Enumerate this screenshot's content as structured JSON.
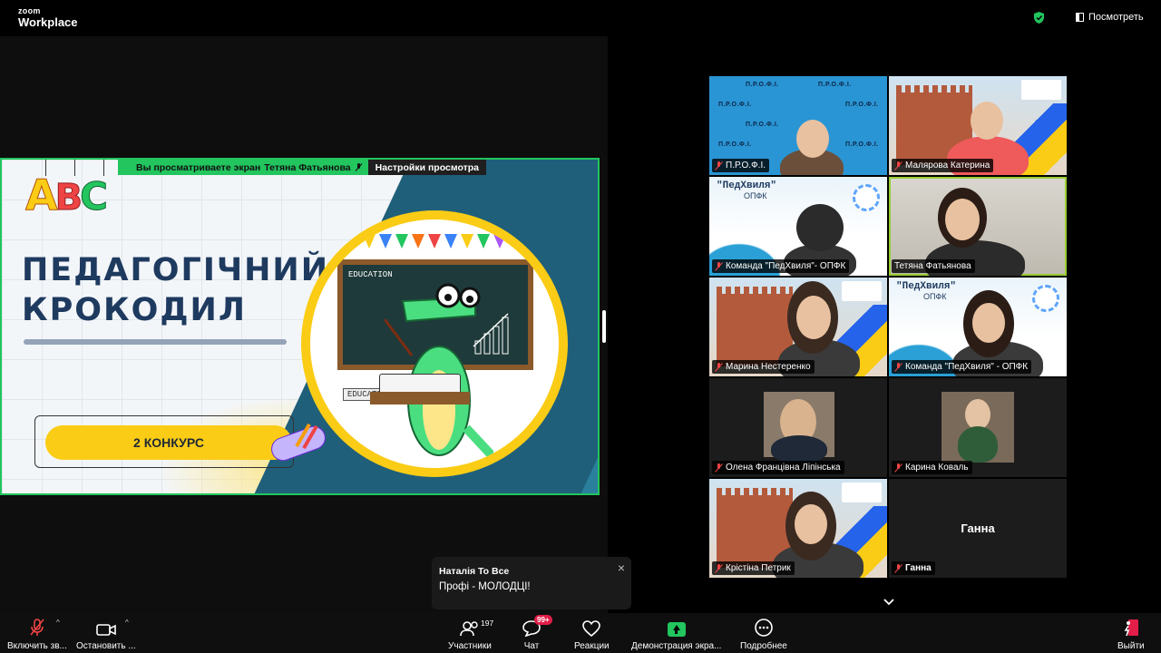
{
  "app": {
    "brand_top": "zoom",
    "brand_bottom": "Workplace",
    "view_button": "Посмотреть"
  },
  "share_banner": {
    "text": "Вы просматриваете экран",
    "presenter": "Тетяна Фатьянова",
    "settings": "Настройки просмотра"
  },
  "slide": {
    "abc": {
      "a": "A",
      "b": "B",
      "c": "C"
    },
    "title_line1": "ПЕДАГОГІЧНИЙ",
    "title_line2": "КРОКОДИЛ",
    "contest": "2 КОНКУРС",
    "board_text": "EDUCATION",
    "board_text2": "EDUCATION",
    "bunting_colors": [
      "#ef4444",
      "#facc15",
      "#3b82f6",
      "#22c55e",
      "#f97316",
      "#ef4444",
      "#3b82f6",
      "#facc15",
      "#22c55e",
      "#a855f7"
    ]
  },
  "participants": [
    {
      "name": "П.Р.О.Ф.І.",
      "bg": "profi"
    },
    {
      "name": "Малярова Катерина",
      "bg": "building"
    },
    {
      "name": "Команда \"ПедХвиля\"- ОПФК",
      "bg": "ped"
    },
    {
      "name": "Тетяна Фатьянова",
      "bg": "room",
      "muted": false,
      "active": true
    },
    {
      "name": "Марина Нестеренко",
      "bg": "building"
    },
    {
      "name": "Команда \"ПедХвиля\" - ОПФК",
      "bg": "ped"
    },
    {
      "name": "Олена Францівна Ліпінська",
      "bg": "dark"
    },
    {
      "name": "Карина Коваль",
      "bg": "dark"
    },
    {
      "name": "Крістіна Петрик",
      "bg": "building"
    },
    {
      "name": "Ганна",
      "bg": "none",
      "center_name": "Ганна"
    }
  ],
  "tile_backgrounds": {
    "profi_pattern": "П.Р.О.Ф.І.",
    "ped_title": "\"ПедХвиля\"",
    "ped_sub": "ОПФК"
  },
  "chat_toast": {
    "from": "Наталія To Все",
    "message": "Профі - МОЛОДЦІ!",
    "close": "×"
  },
  "toolbar": {
    "audio": "Включить зв...",
    "video": "Остановить ...",
    "participants": "Участники",
    "participants_count": "197",
    "chat": "Чат",
    "chat_badge": "99+",
    "reactions": "Реакции",
    "share": "Демонстрация экра...",
    "more": "Подробнее",
    "leave": "Выйти"
  },
  "colors": {
    "accent_green": "#22c55e",
    "leave_red": "#e11d48"
  }
}
